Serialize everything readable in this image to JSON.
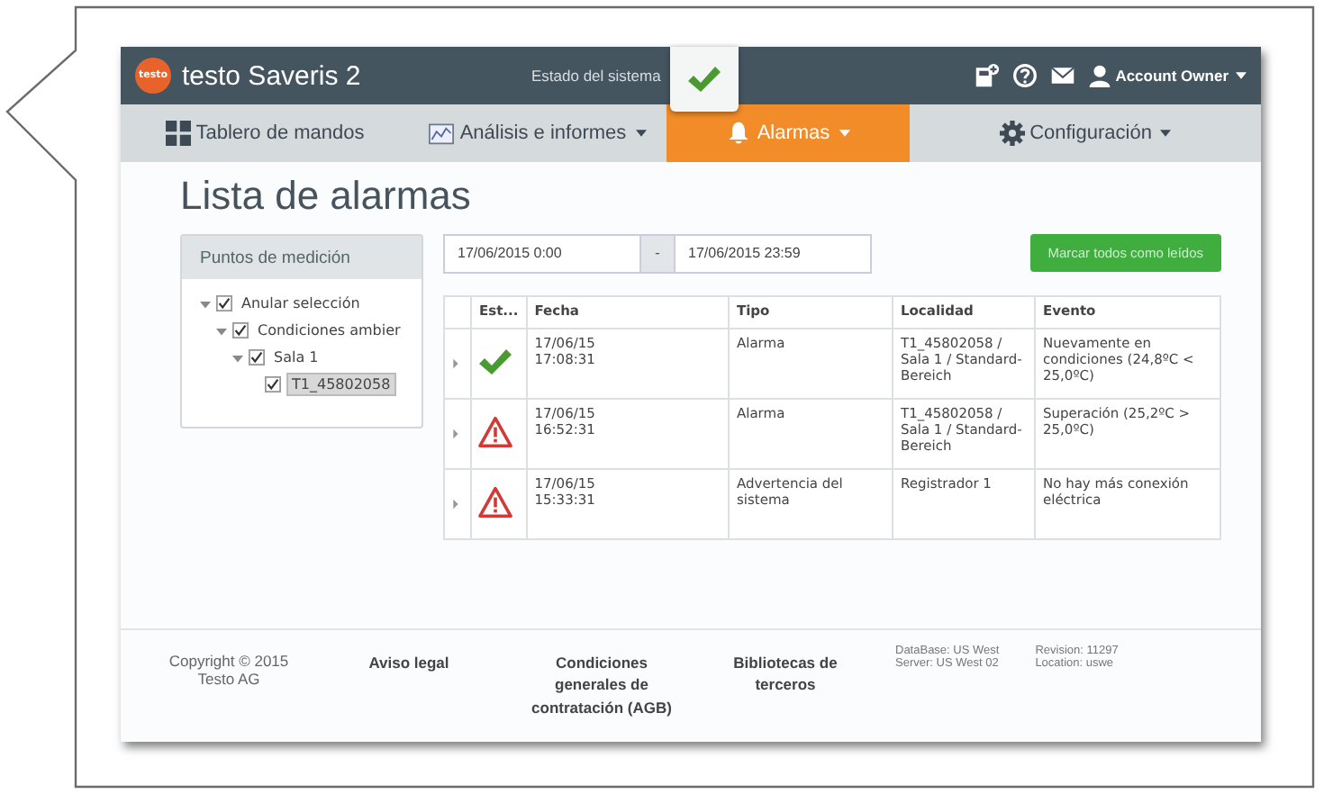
{
  "app": {
    "name": "testo Saveris 2",
    "logo": "testo",
    "system_status_label": "Estado del sistema",
    "system_status": {
      "kind": "ok"
    },
    "user": "Account Owner"
  },
  "nav": [
    {
      "label": "Tablero de mandos",
      "kind": "grid",
      "dropdown": false,
      "selected": false
    },
    {
      "label": "Análisis e informes",
      "kind": "chart",
      "dropdown": true,
      "selected": false
    },
    {
      "label": "Alarmas",
      "kind": "bell",
      "dropdown": true,
      "selected": true
    },
    {
      "label": "Configuración",
      "kind": "gear",
      "dropdown": true,
      "selected": false
    }
  ],
  "page_title": "Lista de alarmas",
  "sidebar": {
    "title": "Puntos de medición",
    "tree": [
      {
        "label": "Anular selección",
        "checked": true,
        "expanded": true,
        "selected": false,
        "children": [
          {
            "label": "Condiciones ambier",
            "checked": true,
            "expanded": true,
            "selected": false,
            "children": [
              {
                "label": "Sala 1",
                "checked": true,
                "expanded": true,
                "selected": false,
                "children": [
                  {
                    "label": "T1_45802058",
                    "checked": true,
                    "selected": true
                  }
                ]
              }
            ]
          }
        ]
      }
    ]
  },
  "date_range": {
    "from": "17/06/2015 0:00",
    "separator": "-",
    "to": "17/06/2015 23:59"
  },
  "mark_all_button": "Marcar todos como leídos",
  "table": {
    "columns": [
      "Est...",
      "Fecha",
      "Tipo",
      "Localidad",
      "Evento"
    ],
    "rows": [
      {
        "kind": "ok",
        "date": "17/06/15",
        "time": "17:08:31",
        "type": "Alarma",
        "location": "T1_45802058 / Sala 1 / Standard-Bereich",
        "event": "Nuevamente en condiciones (24,8ºC < 25,0ºC)"
      },
      {
        "kind": "alert",
        "date": "17/06/15",
        "time": "16:52:31",
        "type": "Alarma",
        "location": "T1_45802058 / Sala 1 / Standard-Bereich",
        "event": "Superación (25,2ºC > 25,0ºC)"
      },
      {
        "kind": "alert",
        "date": "17/06/15",
        "time": "15:33:31",
        "type": "Advertencia del sistema",
        "location": "Registrador 1",
        "event": "No hay más conexión eléctrica"
      }
    ]
  },
  "footer": {
    "copyright": "Copyright © 2015 Testo AG",
    "links": [
      "Aviso legal",
      "Condiciones generales de contratación (AGB)",
      "Bibliotecas de terceros"
    ],
    "server_info": [
      "DataBase: US West",
      "Server: US West 02"
    ],
    "revision_info": [
      "Revision: 11297",
      "Location: uswe"
    ]
  }
}
